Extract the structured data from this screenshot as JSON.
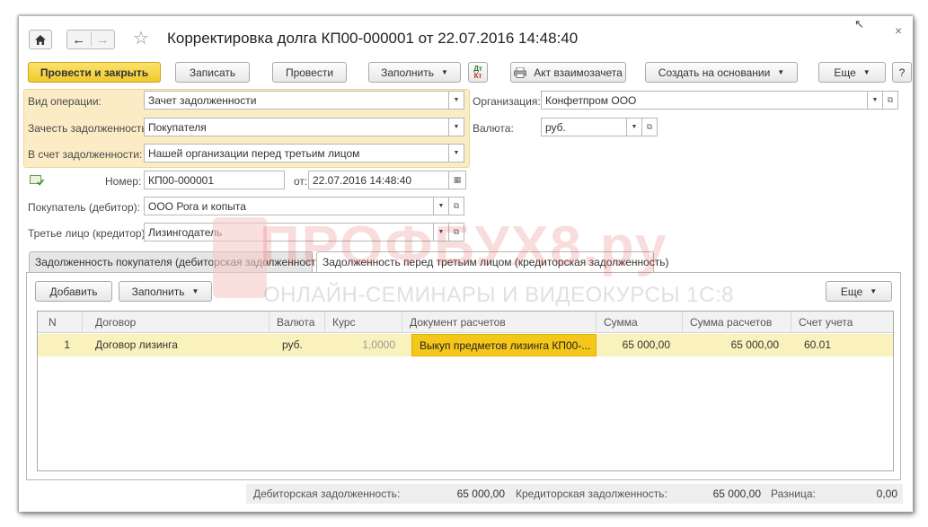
{
  "window": {
    "title": "Корректировка долга КП00-000001 от 22.07.2016 14:48:40"
  },
  "toolbar": {
    "post_close": "Провести и закрыть",
    "save": "Записать",
    "post": "Провести",
    "fill": "Заполнить",
    "act": "Акт взаимозачета",
    "create_based": "Создать на основании",
    "more": "Еще",
    "help": "?"
  },
  "form": {
    "operation_type": {
      "label": "Вид операции:",
      "value": "Зачет задолженности"
    },
    "offset_debt": {
      "label": "Зачесть задолженность:",
      "value": "Покупателя"
    },
    "against_debt": {
      "label": "В счет задолженности:",
      "value": "Нашей организации перед третьим лицом"
    },
    "organization": {
      "label": "Организация:",
      "value": "Конфетпром ООО"
    },
    "currency": {
      "label": "Валюта:",
      "value": "руб."
    },
    "number": {
      "label": "Номер:",
      "value": "КП00-000001"
    },
    "date": {
      "label": "от:",
      "value": "22.07.2016 14:48:40"
    },
    "buyer": {
      "label": "Покупатель (дебитор):",
      "value": "ООО Рога и копыта"
    },
    "third_party": {
      "label": "Третье лицо (кредитор):",
      "value": "Лизингодатель"
    }
  },
  "watermark": {
    "brand": "ПРОФБУХ8.ру",
    "subtitle": "ОНЛАЙН-СЕМИНАРЫ И ВИДЕОКУРСЫ 1С:8"
  },
  "tabs": [
    {
      "label": "Задолженность покупателя (дебиторская задолженность)",
      "active": false
    },
    {
      "label": "Задолженность перед третьим лицом (кредиторская задолженность)",
      "active": true
    }
  ],
  "tab_toolbar": {
    "add": "Добавить",
    "fill": "Заполнить",
    "more": "Еще"
  },
  "table": {
    "columns": [
      "N",
      "Договор",
      "Валюта",
      "Курс",
      "Документ расчетов",
      "Сумма",
      "Сумма расчетов",
      "Счет учета"
    ],
    "rows": [
      {
        "n": "1",
        "contract": "Договор лизинга",
        "currency": "руб.",
        "rate": "1,0000",
        "document": "Выкуп предметов лизинга КП00-...",
        "sum": "65 000,00",
        "settlement_sum": "65 000,00",
        "account": "60.01"
      }
    ]
  },
  "footer": {
    "receivable_label": "Дебиторская задолженность:",
    "receivable_value": "65 000,00",
    "payable_label": "Кредиторская задолженность:",
    "payable_value": "65 000,00",
    "diff_label": "Разница:",
    "diff_value": "0,00"
  },
  "colors": {
    "primary_button": "#f1c930",
    "highlight_panel": "#fbecc5",
    "selected_row": "#faf2bd",
    "selected_cell": "#f5c71a"
  }
}
